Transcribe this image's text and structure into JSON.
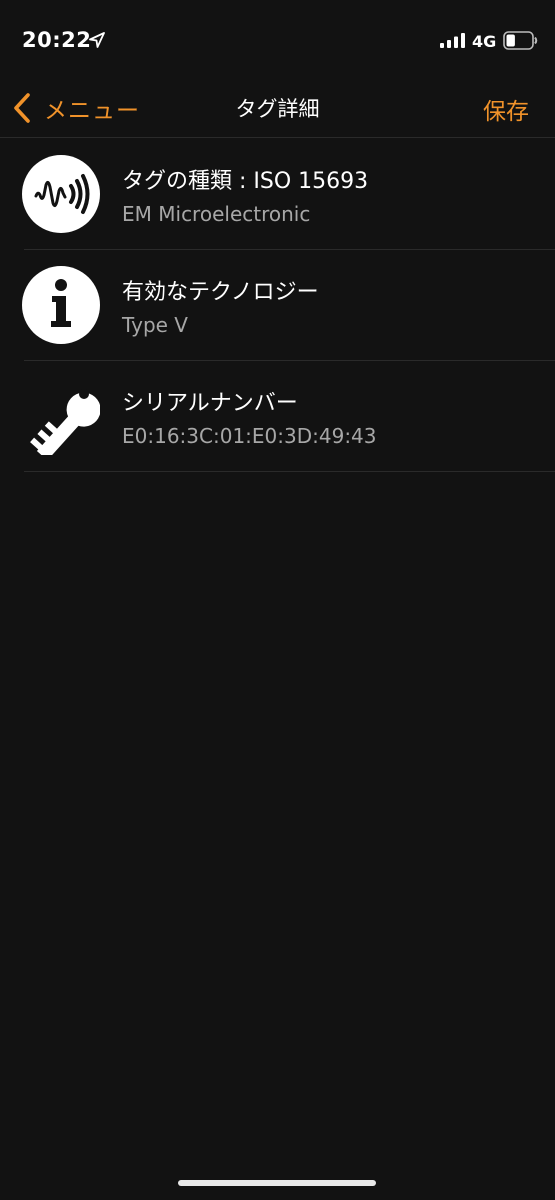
{
  "status_bar": {
    "time": "20:22",
    "network": "4G",
    "battery_level": 0.35
  },
  "nav": {
    "back_label": "メニュー",
    "title": "タグ詳細",
    "save_label": "保存",
    "accent_color": "#f0922a"
  },
  "items": [
    {
      "icon": "nfc-signal-icon",
      "title": "タグの種類 : ISO 15693",
      "subtitle": "EM Microelectronic"
    },
    {
      "icon": "info-icon",
      "title": "有効なテクノロジー",
      "subtitle": "Type V"
    },
    {
      "icon": "key-icon",
      "title": "シリアルナンバー",
      "subtitle": "E0:16:3C:01:E0:3D:49:43"
    }
  ]
}
